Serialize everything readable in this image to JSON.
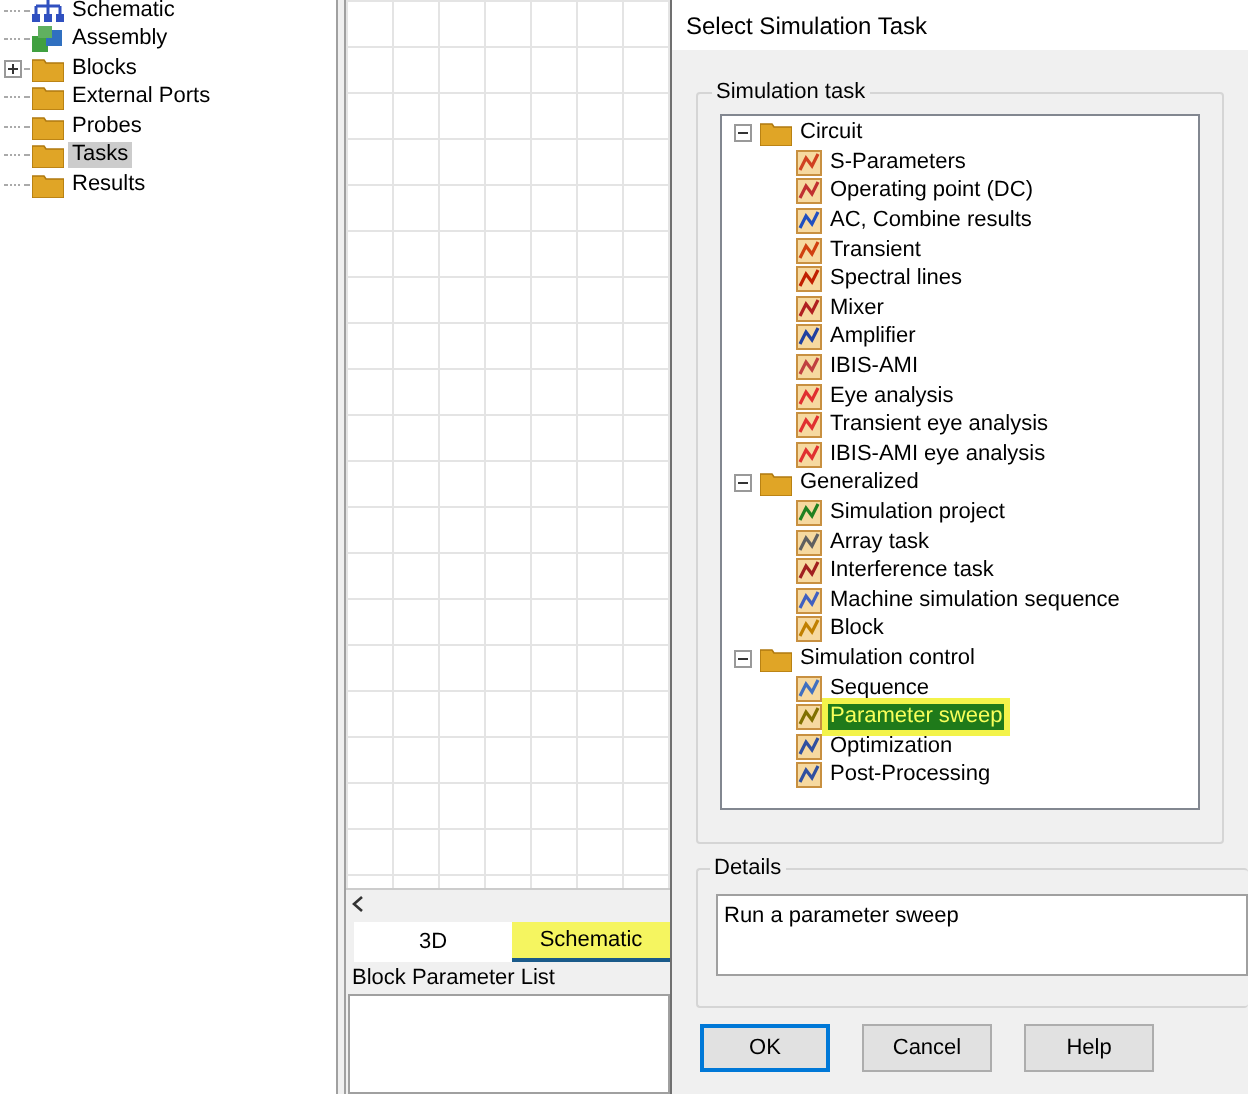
{
  "project_tree": {
    "items": [
      {
        "label": "Schematic",
        "selected": false,
        "expandable": false,
        "kind": "schematic"
      },
      {
        "label": "Assembly",
        "selected": false,
        "expandable": false,
        "kind": "assembly"
      },
      {
        "label": "Blocks",
        "selected": false,
        "expandable": true,
        "kind": "folder"
      },
      {
        "label": "External Ports",
        "selected": false,
        "expandable": false,
        "kind": "folder"
      },
      {
        "label": "Probes",
        "selected": false,
        "expandable": false,
        "kind": "folder"
      },
      {
        "label": "Tasks",
        "selected": true,
        "expandable": false,
        "kind": "folder"
      },
      {
        "label": "Results",
        "selected": false,
        "expandable": false,
        "kind": "folder"
      }
    ]
  },
  "view_tabs": [
    {
      "label": "3D",
      "selected": false
    },
    {
      "label": "Schematic",
      "selected": true
    }
  ],
  "parameter_panel": {
    "title": "Block Parameter List"
  },
  "dialog": {
    "title": "Select Simulation Task",
    "task_group": {
      "title": "Simulation task",
      "categories": [
        {
          "label": "Circuit",
          "expanded": true,
          "children": [
            {
              "label": "S-Parameters",
              "selected": false
            },
            {
              "label": "Operating point (DC)",
              "selected": false
            },
            {
              "label": "AC, Combine results",
              "selected": false
            },
            {
              "label": "Transient",
              "selected": false
            },
            {
              "label": "Spectral lines",
              "selected": false
            },
            {
              "label": "Mixer",
              "selected": false
            },
            {
              "label": "Amplifier",
              "selected": false
            },
            {
              "label": "IBIS-AMI",
              "selected": false
            },
            {
              "label": "Eye analysis",
              "selected": false
            },
            {
              "label": "Transient eye analysis",
              "selected": false
            },
            {
              "label": "IBIS-AMI eye analysis",
              "selected": false
            }
          ]
        },
        {
          "label": "Generalized",
          "expanded": true,
          "children": [
            {
              "label": "Simulation project",
              "selected": false
            },
            {
              "label": "Array task",
              "selected": false
            },
            {
              "label": "Interference task",
              "selected": false
            },
            {
              "label": "Machine simulation sequence",
              "selected": false
            },
            {
              "label": "Block",
              "selected": false
            }
          ]
        },
        {
          "label": "Simulation control",
          "expanded": true,
          "children": [
            {
              "label": "Sequence",
              "selected": false
            },
            {
              "label": "Parameter sweep",
              "selected": true
            },
            {
              "label": "Optimization",
              "selected": false
            },
            {
              "label": "Post-Processing",
              "selected": false
            }
          ]
        }
      ]
    },
    "details": {
      "title": "Details",
      "text": "Run a parameter sweep"
    },
    "buttons": [
      {
        "label": "OK",
        "default": true
      },
      {
        "label": "Cancel",
        "default": false
      },
      {
        "label": "Help",
        "default": false
      }
    ]
  }
}
